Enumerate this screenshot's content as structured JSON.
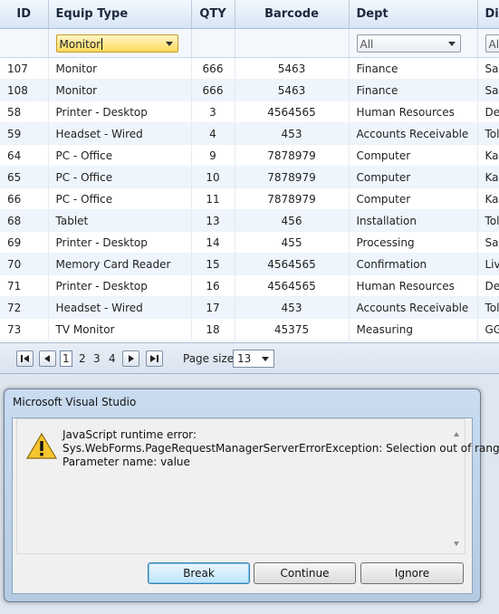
{
  "grid": {
    "columns": [
      "ID",
      "Equip Type",
      "QTY",
      "Barcode",
      "Dept",
      "Div"
    ],
    "filters": {
      "equip_type": "Monitor",
      "dept": "All",
      "div": "All"
    },
    "rows": [
      {
        "id": "107",
        "equip": "Monitor",
        "qty": "666",
        "barcode": "5463",
        "dept": "Finance",
        "div": "Sag"
      },
      {
        "id": "108",
        "equip": "Monitor",
        "qty": "666",
        "barcode": "5463",
        "dept": "Finance",
        "div": "Sag"
      },
      {
        "id": "58",
        "equip": "Printer - Desktop",
        "qty": "3",
        "barcode": "4564565",
        "dept": "Human Resources",
        "div": "Det"
      },
      {
        "id": "59",
        "equip": "Headset - Wired",
        "qty": "4",
        "barcode": "453",
        "dept": "Accounts Receivable",
        "div": "Tol"
      },
      {
        "id": "64",
        "equip": "PC - Office",
        "qty": "9",
        "barcode": "7878979",
        "dept": "Computer",
        "div": "Kal"
      },
      {
        "id": "65",
        "equip": "PC - Office",
        "qty": "10",
        "barcode": "7878979",
        "dept": "Computer",
        "div": "Kal"
      },
      {
        "id": "66",
        "equip": "PC - Office",
        "qty": "11",
        "barcode": "7878979",
        "dept": "Computer",
        "div": "Kal"
      },
      {
        "id": "68",
        "equip": "Tablet",
        "qty": "13",
        "barcode": "456",
        "dept": "Installation",
        "div": "Tol"
      },
      {
        "id": "69",
        "equip": "Printer - Desktop",
        "qty": "14",
        "barcode": "455",
        "dept": "Processing",
        "div": "Sag"
      },
      {
        "id": "70",
        "equip": "Memory Card Reader",
        "qty": "15",
        "barcode": "4564565",
        "dept": "Confirmation",
        "div": "Liv"
      },
      {
        "id": "71",
        "equip": "Printer - Desktop",
        "qty": "16",
        "barcode": "4564565",
        "dept": "Human Resources",
        "div": "Det"
      },
      {
        "id": "72",
        "equip": "Headset - Wired",
        "qty": "17",
        "barcode": "453",
        "dept": "Accounts Receivable",
        "div": "Tol"
      },
      {
        "id": "73",
        "equip": "TV Monitor",
        "qty": "18",
        "barcode": "45375",
        "dept": "Measuring",
        "div": "GG"
      }
    ]
  },
  "pager": {
    "pages": [
      "1",
      "2",
      "3",
      "4"
    ],
    "current_page": "1",
    "page_size_label": "Page size:",
    "page_size": "13"
  },
  "dialog": {
    "title": "Microsoft Visual Studio",
    "message_line1": "JavaScript runtime error:",
    "message_line2": "Sys.WebForms.PageRequestManagerServerErrorException: Selection out of range",
    "message_line3": "Parameter name: value",
    "buttons": {
      "break": "Break",
      "continue": "Continue",
      "ignore": "Ignore"
    }
  }
}
